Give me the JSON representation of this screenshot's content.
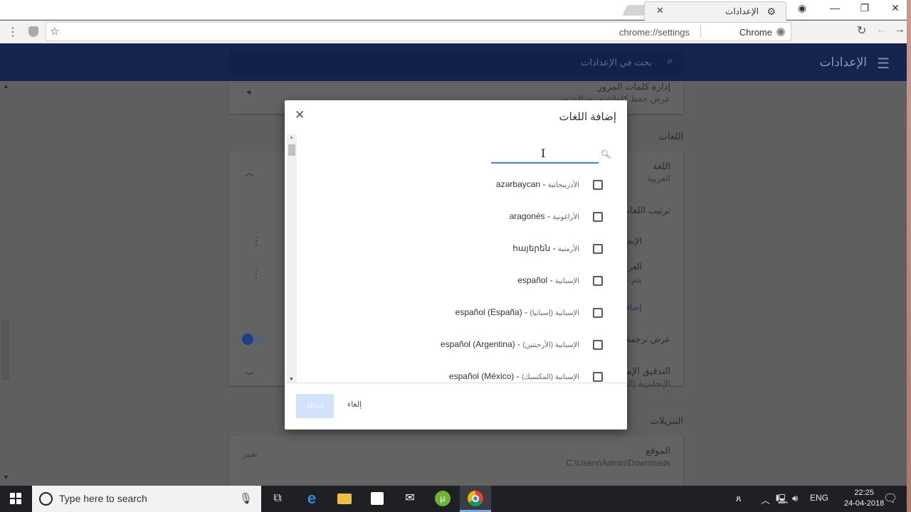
{
  "browser": {
    "tab_title": "الإعدادات",
    "tab_icon": "gear-icon",
    "url": "chrome://settings",
    "site_label": "Chrome",
    "window_controls": [
      "minimize",
      "restore",
      "close"
    ]
  },
  "settings": {
    "header_title": "الإعدادات",
    "search_placeholder": "بحث في الإعدادات"
  },
  "background_page": {
    "passwords": {
      "title": "إدارة كلمات المرور",
      "subtitle": "عرض حفظ كلمات مرور المرور"
    },
    "languages_heading": "اللغات",
    "language": {
      "title": "اللغة",
      "value": "العربية"
    },
    "language_order": "ترتيب اللغات",
    "lang_row_1": "الإنجليزية",
    "lang_row_2": "العربية",
    "lang_row_2_sub": "يتم عرض",
    "add_languages_link": "إضافة",
    "offer_translate": "عرض ترجمة",
    "spellcheck": {
      "title": "التدقيق الإملائي",
      "value": "الإنجليزية (الولايات المتحدة)"
    },
    "downloads_heading": "التنزيلات",
    "location": {
      "title": "الموقع",
      "value": "C:\\Users\\Admin\\Downloads",
      "change_label": "تغيير"
    }
  },
  "dialog": {
    "title": "إضافة اللغات",
    "search_value": "",
    "languages": [
      {
        "native": "azərbaycan",
        "arabic": "الأذربيجانية",
        "checked": false
      },
      {
        "native": "aragonés",
        "arabic": "الأراغونية",
        "checked": false
      },
      {
        "native": "հայերեն",
        "arabic": "الأرمنية",
        "checked": false
      },
      {
        "native": "español",
        "arabic": "الإسبانية",
        "checked": false
      },
      {
        "native": "español (España)",
        "arabic": "الإسبانية (إسبانيا)",
        "checked": false
      },
      {
        "native": "español (Argentina)",
        "arabic": "الإسبانية (الأرجنتين)",
        "checked": false
      },
      {
        "native": "español (México)",
        "arabic": "الإسبانية (المكسيك)",
        "checked": false
      }
    ],
    "add_button": "إضافة",
    "cancel_button": "إلغاء"
  },
  "taskbar": {
    "search_placeholder": "Type here to search",
    "apps": [
      "task-view",
      "edge",
      "file-explorer",
      "store",
      "mail",
      "utorrent",
      "chrome"
    ],
    "language": "ENG",
    "time": "22:25",
    "date": "24-04-2018"
  },
  "colors": {
    "header_bg": "#15244f",
    "accent": "#3f7fd9",
    "add_button_disabled": "#d2e2fc"
  }
}
